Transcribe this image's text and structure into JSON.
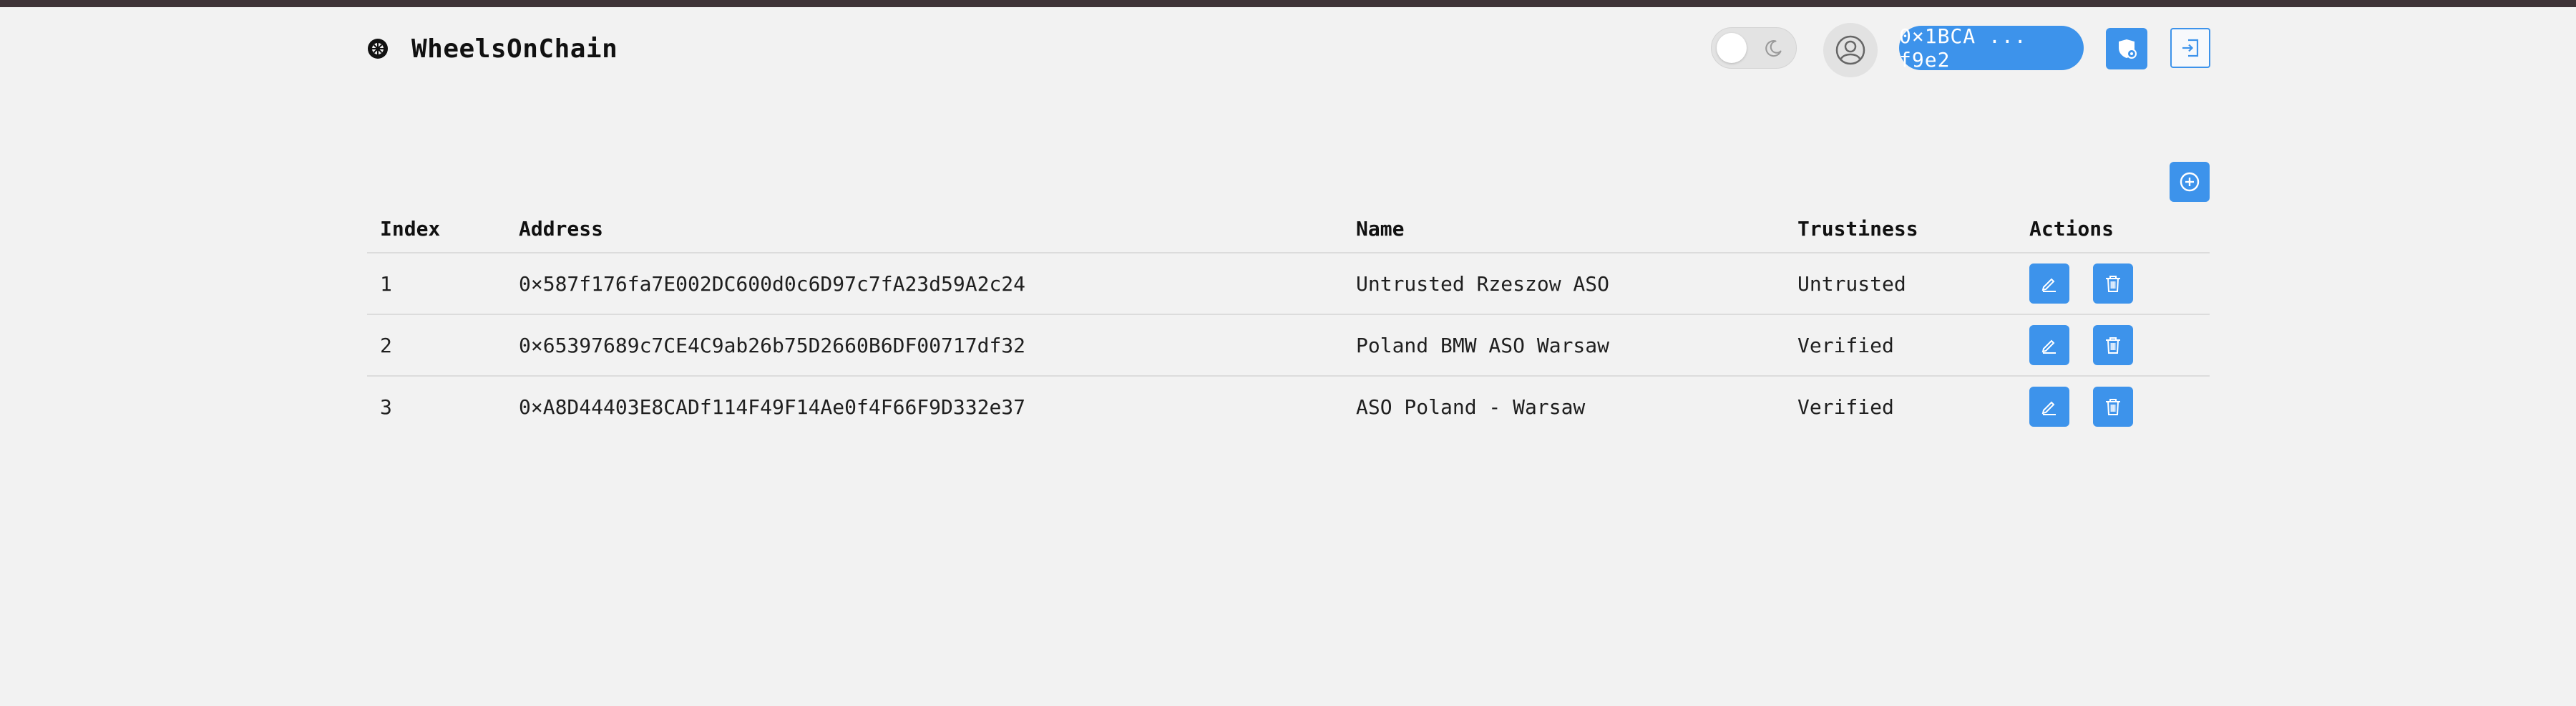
{
  "app": {
    "title": "WheelsOnChain",
    "logo_icon": "wheel-icon"
  },
  "header": {
    "theme_toggle": {
      "mode": "light",
      "icon": "moon-icon"
    },
    "profile_icon": "user-circle-icon",
    "wallet_label": "0×1BCA ... f9e2",
    "network_icon": "shield-network-icon",
    "logout_icon": "logout-icon"
  },
  "toolbar": {
    "add_icon": "plus-circle-icon"
  },
  "table": {
    "columns": [
      "Index",
      "Address",
      "Name",
      "Trustiness",
      "Actions"
    ],
    "rows": [
      {
        "index": "1",
        "address": "0×587f176fa7E002DC600d0c6D97c7fA23d59A2c24",
        "name": "Untrusted Rzeszow ASO",
        "trust": "Untrusted"
      },
      {
        "index": "2",
        "address": "0×65397689c7CE4C9ab26b75D2660B6DF00717df32",
        "name": "Poland BMW ASO Warsaw",
        "trust": "Verified"
      },
      {
        "index": "3",
        "address": "0×A8D44403E8CADf114F49F14Ae0f4F66F9D332e37",
        "name": "ASO Poland - Warsaw",
        "trust": "Verified"
      }
    ],
    "row_actions": {
      "edit_icon": "pencil-icon",
      "delete_icon": "trash-icon"
    }
  },
  "colors": {
    "accent": "#3d93eb",
    "untrusted": "#e25a5a",
    "verified": "#57b86a",
    "background": "#f2f2f2",
    "topbar": "#3f3438"
  }
}
